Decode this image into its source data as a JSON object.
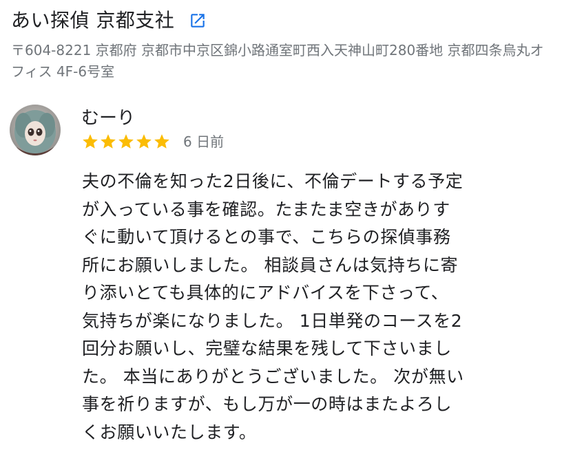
{
  "business": {
    "name": "あい探偵 京都支社",
    "external_link_icon": "open-in-new-icon",
    "address": "〒604-8221 京都府 京都市中京区錦小路通室町西入天神山町280番地 京都四条烏丸オフィス 4F-6号室"
  },
  "review": {
    "reviewer_name": "むーり",
    "rating": 5,
    "rating_max": 5,
    "star_color": "#fbbc04",
    "date": "6 日前",
    "text": "夫の不倫を知った2日後に、不倫デートする予定\nが入っている事を確認。たまたま空きがありす\nぐに動いて頂けるとの事で、こちらの探偵事務\n所にお願いしました。 相談員さんは気持ちに寄\nり添いとても具体的にアドバイスを下さって、\n気持ちが楽になりました。 1日単発のコースを2\n回分お願いし、完璧な結果を残して下さいまし\nた。 本当にありがとうございました。 次が無い\n事を祈りますが、もし万が一の時はまたよろし\nくお願いいたします。"
  },
  "colors": {
    "link_blue": "#1a73e8",
    "secondary_text": "#70757a",
    "primary_text": "#202124"
  }
}
